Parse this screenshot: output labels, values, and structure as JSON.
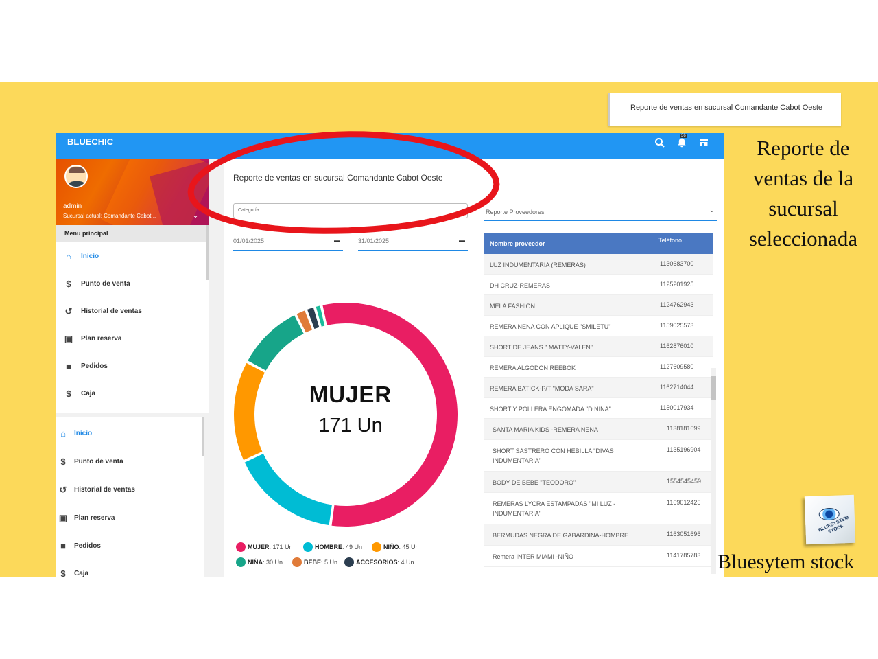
{
  "popup": {
    "text": "Reporte de ventas en sucursal Comandante Cabot Oeste"
  },
  "app": {
    "brand": "BLUECHIC",
    "notifications_count": "36"
  },
  "sidebar": {
    "user": "admin",
    "branch": "Sucursal actual: Comandante Cabot...",
    "menu_label": "Menu principal",
    "items": [
      {
        "label": "Inicio",
        "icon": "home-icon"
      },
      {
        "label": "Punto de venta",
        "icon": "dollar-icon"
      },
      {
        "label": "Historial de ventas",
        "icon": "history-icon"
      },
      {
        "label": "Plan reserva",
        "icon": "wallet-icon"
      },
      {
        "label": "Pedidos",
        "icon": "briefcase-icon"
      },
      {
        "label": "Caja",
        "icon": "cash-icon"
      }
    ]
  },
  "report": {
    "title": "Reporte de ventas en sucursal Comandante Cabot Oeste",
    "category_placeholder": "Categoría",
    "date_from": "01/01/2025",
    "date_to": "31/01/2025",
    "providers_select": "Reporte Proveedores"
  },
  "donut": {
    "center_label": "MUJER",
    "center_value": "171 Un",
    "slices": [
      {
        "name": "MUJER",
        "value": 171,
        "unit": "Un",
        "color": "#e91e63"
      },
      {
        "name": "HOMBRE",
        "value": 49,
        "unit": "Un",
        "color": "#00bcd4"
      },
      {
        "name": "NIÑO",
        "value": 45,
        "unit": "Un",
        "color": "#ff9800"
      },
      {
        "name": "NIÑA",
        "value": 30,
        "unit": "Un",
        "color": "#17a589"
      },
      {
        "name": "BEBE",
        "value": 5,
        "unit": "Un",
        "color": "#e07b39"
      },
      {
        "name": "ACCESORIOS",
        "value": 4,
        "unit": "Un",
        "color": "#2c3e50"
      },
      {
        "name": "",
        "value": 3,
        "unit": "",
        "color": "#1abc9c"
      }
    ]
  },
  "legend": [
    {
      "name": "MUJER",
      "value": "171 Un",
      "color": "#e91e63"
    },
    {
      "name": "HOMBRE",
      "value": "49 Un",
      "color": "#00bcd4"
    },
    {
      "name": "NIÑO",
      "value": "45 Un",
      "color": "#ff9800"
    },
    {
      "name": "NIÑA",
      "value": "30 Un",
      "color": "#17a589"
    },
    {
      "name": "BEBE",
      "value": "5 Un",
      "color": "#e07b39"
    },
    {
      "name": "ACCESORIOS",
      "value": "4 Un",
      "color": "#2c3e50"
    }
  ],
  "providers": {
    "headers": [
      "Nombre proveedor",
      "Teléfono"
    ],
    "rows": [
      [
        "LUZ INDUMENTARIA (REMERAS)",
        "1130683700"
      ],
      [
        "DH CRUZ-REMERAS",
        "1125201925"
      ],
      [
        "MELA FASHION",
        "1124762943"
      ],
      [
        "REMERA NENA CON APLIQUE \"SMILETU\"",
        "1159025573"
      ],
      [
        "SHORT DE JEANS \" MATTY-VALEN\"",
        "1162876010"
      ],
      [
        "REMERA ALGODON REEBOK",
        "1127609580"
      ],
      [
        "REMERA BATICK-P/T \"MODA SARA\"",
        "1162714044"
      ],
      [
        "SHORT Y POLLERA ENGOMADA \"D NINA\"",
        "1150017934"
      ],
      [
        "SANTA MARIA KIDS -REMERA NENA",
        "1138181699"
      ],
      [
        "SHORT SASTRERO CON HEBILLA \"DIVAS INDUMENTARIA\"",
        "1135196904"
      ],
      [
        "BODY DE BEBE \"TEODORO\"",
        "1554545459"
      ],
      [
        "REMERAS LYCRA ESTAMPADAS \"MI LUZ - INDUMENTARIA\"",
        "1169012425"
      ],
      [
        "BERMUDAS NEGRA DE GABARDINA-HOMBRE",
        "1163051696"
      ],
      [
        "Remera INTER MIAMI -NIÑO",
        "1141785783"
      ]
    ]
  },
  "annotation": {
    "lines": [
      "Reporte de",
      "ventas de la",
      "sucursal",
      "seleccionada"
    ],
    "brand": "Bluesytem stock",
    "logo_text": "BLUESYSTEM STOCK"
  },
  "colors": {
    "accent": "#2196f3",
    "highlight_circle": "#e8151b",
    "background": "#fcd95a"
  }
}
